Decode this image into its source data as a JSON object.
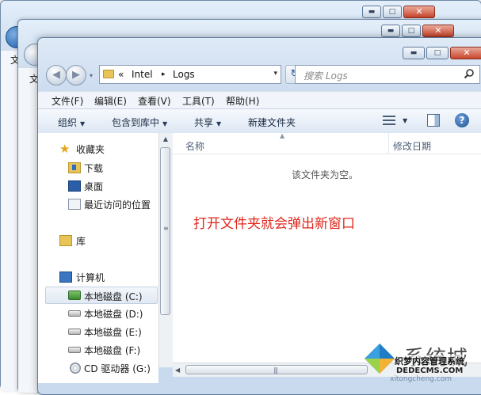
{
  "window": {
    "minimize_glyph": "▬",
    "maximize_glyph": "□",
    "close_glyph": "✕"
  },
  "background_windows": {
    "menu_char": "文"
  },
  "address": {
    "chevron": "«",
    "crumbs": [
      "Intel",
      "Logs"
    ],
    "separator": "▸",
    "dropdown_glyph": "▾",
    "refresh_glyph": "↻"
  },
  "search": {
    "placeholder": "搜索 Logs",
    "icon": "search-icon"
  },
  "menu": {
    "file": "文件(F)",
    "edit": "编辑(E)",
    "view": "查看(V)",
    "tools": "工具(T)",
    "help": "帮助(H)"
  },
  "toolbar": {
    "organize": "组织",
    "include_library": "包含到库中",
    "share": "共享",
    "new_folder": "新建文件夹",
    "dropdown_glyph": "▼",
    "help_glyph": "?"
  },
  "nav_pane": {
    "favorites": "收藏夹",
    "downloads": "下载",
    "desktop": "桌面",
    "recent": "最近访问的位置",
    "libraries": "库",
    "computer": "计算机",
    "drives": [
      {
        "label": "本地磁盘 (C:)",
        "selected": true
      },
      {
        "label": "本地磁盘 (D:)",
        "selected": false
      },
      {
        "label": "本地磁盘 (E:)",
        "selected": false
      },
      {
        "label": "本地磁盘 (F:)",
        "selected": false
      },
      {
        "label": "CD 驱动器 (G:)",
        "selected": false
      }
    ]
  },
  "content": {
    "col_name": "名称",
    "col_date": "修改日期",
    "sort_glyph": "▲",
    "empty_message": "该文件夹为空。",
    "annotation": "打开文件夹就会弹出新窗口"
  },
  "scroll": {
    "up": "▲",
    "left": "◀",
    "right": "▶",
    "grip": "≡",
    "hgrip": "|||"
  },
  "watermark": {
    "brand": "系统城",
    "line1": "织梦内容管理系统",
    "line2": "DEDECMS.COM",
    "site": "xitongcheng.com"
  },
  "colors": {
    "annotation": "#e0261c",
    "accent": "#2f6fc3"
  }
}
